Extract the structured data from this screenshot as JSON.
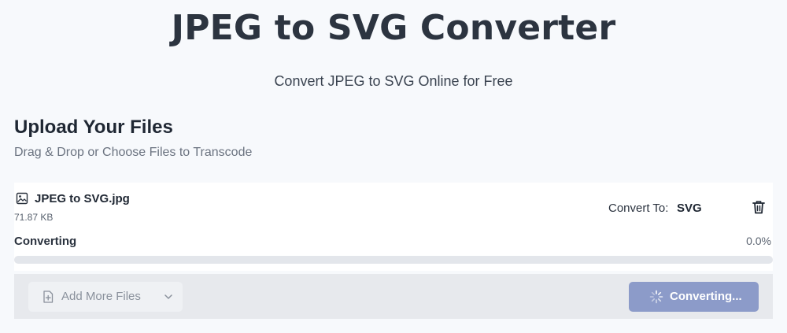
{
  "hero": {
    "title": "JPEG to SVG Converter",
    "subtitle": "Convert JPEG to SVG Online for Free"
  },
  "upload": {
    "title": "Upload Your Files",
    "subtitle": "Drag & Drop or Choose Files to Transcode"
  },
  "file": {
    "icon": "image-file-icon",
    "name": "JPEG to SVG.jpg",
    "size": "71.87 KB",
    "convert_to_label": "Convert To:",
    "convert_to_value": "SVG",
    "status": "Converting",
    "progress_text": "0.0%",
    "progress": 0.0,
    "delete_icon": "trash-icon"
  },
  "actions": {
    "add_more_label": "Add More Files",
    "add_more_icon": "add-file-icon",
    "chevron_icon": "chevron-down-icon",
    "converting_label": "Converting...",
    "spinner_icon": "spinner-icon"
  },
  "colors": {
    "accent": "#8c9bc9",
    "progress_track": "#e3e6eb"
  }
}
